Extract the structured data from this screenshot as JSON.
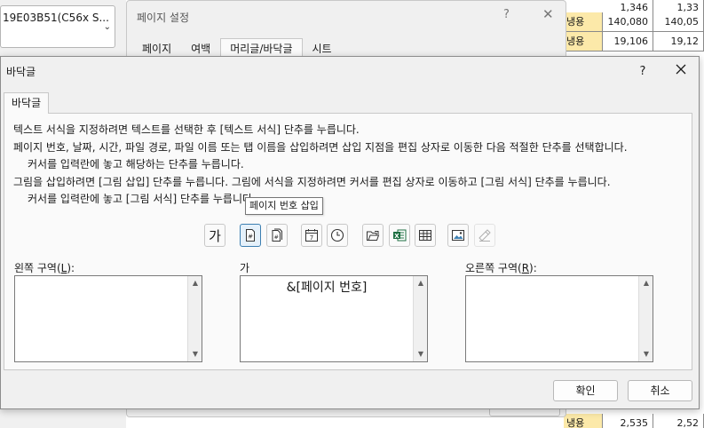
{
  "left_panel": {
    "combo_value": "19E03B51(C56x S..."
  },
  "spreadsheet": {
    "rows": [
      {
        "label": "",
        "v1": "1,346",
        "v2": "1,33"
      },
      {
        "label": "냉용",
        "v1": "140,080",
        "v2": "140,05"
      },
      {
        "label": "냉용",
        "v1": "19,106",
        "v2": "19,12"
      }
    ],
    "bottom_row": {
      "label": "냉용",
      "v1": "2,535",
      "v2": "2,52"
    }
  },
  "page_setup": {
    "title": "페이지 설정",
    "help": "?",
    "close": "✕",
    "tabs": [
      {
        "label": "페이지"
      },
      {
        "label": "여백"
      },
      {
        "label": "머리글/바닥글",
        "active": true
      },
      {
        "label": "시트"
      }
    ]
  },
  "footer_dialog": {
    "title": "바닥글",
    "help": "?",
    "tab": "바닥글",
    "instructions": [
      "텍스트 서식을 지정하려면 텍스트를 선택한 후 [텍스트 서식] 단추를 누릅니다.",
      "페이지 번호, 날짜, 시간, 파일 경로, 파일 이름 또는 탭 이름을 삽입하려면 삽입 지점을 편집 상자로 이동한 다음 적절한 단추를 선택합니다.",
      "커서를 입력란에 놓고 해당하는 단추를 누릅니다.",
      "그림을 삽입하려면 [그림 삽입] 단추를 누릅니다.  그림에 서식을 지정하려면 커서를 편집 상자로 이동하고 [그림 서식] 단추를 누릅니다.",
      "커서를 입력란에 놓고 [그림 서식] 단추를 누릅니다."
    ],
    "toolbar": {
      "format_text_glyph": "가",
      "tooltip": "페이지 번호 삽입"
    },
    "sections": {
      "left": {
        "label_prefix": "왼쪽 구역(",
        "mnemonic": "L",
        "label_suffix": "):",
        "content": ""
      },
      "center": {
        "label_visible": "가",
        "content": "&[페이지 번호]"
      },
      "right": {
        "label_prefix": "오른쪽 구역(",
        "mnemonic": "R",
        "label_suffix": "):",
        "content": ""
      }
    },
    "ok": "확인",
    "cancel": "취소"
  },
  "colors": {
    "accent": "#3c7fb1",
    "excel_green": "#1d6f42",
    "sheet_yellow": "#fce9a9"
  }
}
